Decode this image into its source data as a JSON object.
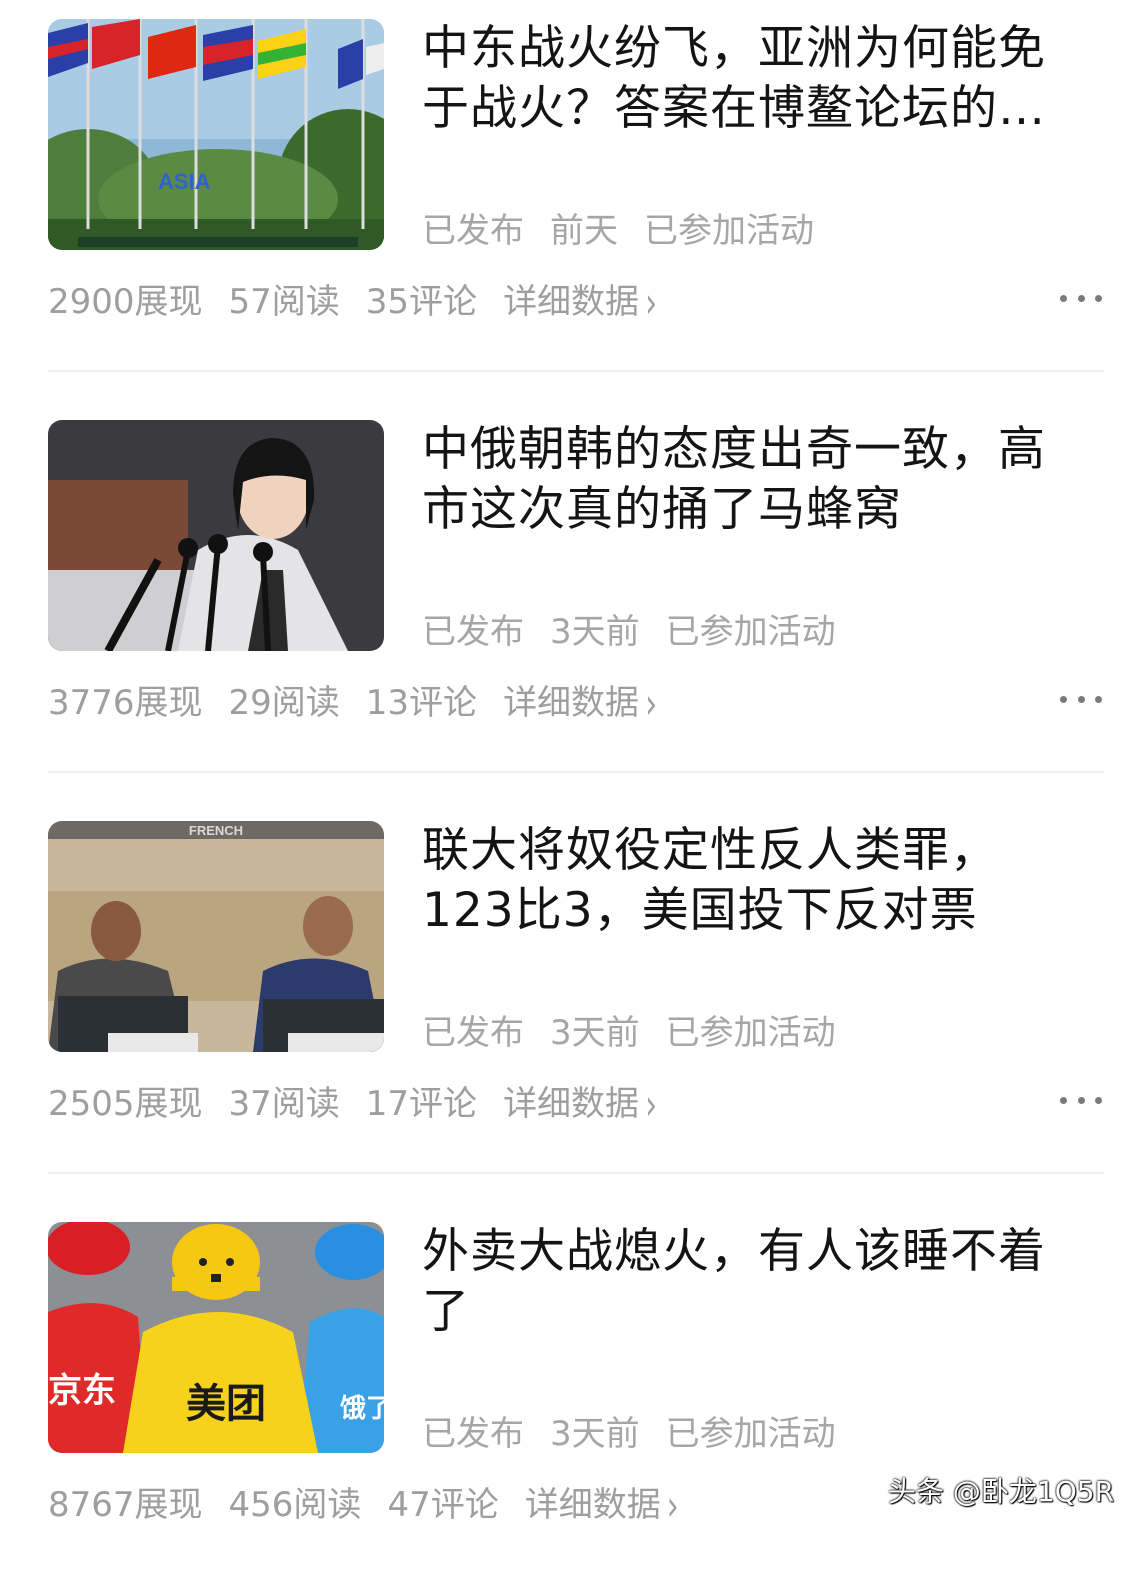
{
  "articles": [
    {
      "title": "中东战火纷飞，亚洲为何能免于战火？答案在博鳌论坛的…",
      "status": "已发布",
      "time": "前天",
      "activity": "已参加活动",
      "views": "2900展现",
      "reads": "57阅读",
      "comments": "35评论",
      "detail": "详细数据",
      "image": "博鳌亚洲论坛 flags and palm trees",
      "image_text": "ASIA"
    },
    {
      "title": "中俄朝韩的态度出奇一致，高市这次真的捅了马蜂窝",
      "status": "已发布",
      "time": "3天前",
      "activity": "已参加活动",
      "views": "3776展现",
      "reads": "29阅读",
      "comments": "13评论",
      "detail": "详细数据",
      "image": "woman speaking at microphones"
    },
    {
      "title": "联大将奴役定性反人类罪，123比3，美国投下反对票",
      "status": "已发布",
      "time": "3天前",
      "activity": "已参加活动",
      "views": "2505展现",
      "reads": "37阅读",
      "comments": "17评论",
      "detail": "详细数据",
      "image": "two delegates at UN session",
      "image_text": "FRENCH"
    },
    {
      "title": "外卖大战熄火，有人该睡不着了",
      "status": "已发布",
      "time": "3天前",
      "activity": "已参加活动",
      "views": "8767展现",
      "reads": "456阅读",
      "comments": "47评论",
      "detail": "详细数据",
      "image": "delivery riders from three platforms",
      "image_labels": [
        "京东",
        "美团",
        "饿了"
      ]
    }
  ],
  "watermark": "头条 @卧龙1Q5R",
  "colors": {
    "title": "#141414",
    "meta": "#a6a6a6",
    "divider": "#efefef"
  },
  "icons": {
    "more": "more-dots-icon",
    "chevron": "chevron-right-icon"
  }
}
